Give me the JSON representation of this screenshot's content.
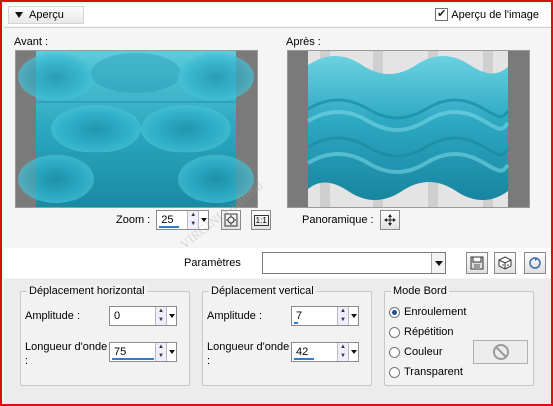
{
  "header": {
    "section_label": "Aperçu",
    "preview_checkbox_label": "Aperçu de l'image",
    "preview_checked": true
  },
  "preview": {
    "before_label": "Avant :",
    "after_label": "Après :",
    "zoom_label": "Zoom :",
    "zoom_value": "25",
    "pan_label": "Panoramique :",
    "icons": [
      "fit-icon",
      "actual-size-icon",
      "move-icon"
    ],
    "actual_size_glyph": "1:1"
  },
  "params": {
    "label": "Paramètres",
    "preset_value": "",
    "icons": [
      "save-preset-icon",
      "randomize-icon",
      "reset-icon"
    ]
  },
  "horizontal": {
    "title": "Déplacement horizontal",
    "amplitude_label": "Amplitude :",
    "amplitude_value": "0",
    "wavelength_label": "Longueur d'onde :",
    "wavelength_value": "75"
  },
  "vertical": {
    "title": "Déplacement vertical",
    "amplitude_label": "Amplitude :",
    "amplitude_value": "7",
    "wavelength_label": "Longueur d'onde :",
    "wavelength_value": "42"
  },
  "edge_mode": {
    "title": "Mode Bord",
    "options": [
      "Enroulement",
      "Répétition",
      "Couleur",
      "Transparent"
    ],
    "selected": "Enroulement"
  },
  "watermark": "VIRGINIA-tutorial",
  "colors": {
    "frame_border": "#d81010",
    "teal": "#2aa6c0",
    "accent_blue": "#2f7dd1"
  }
}
